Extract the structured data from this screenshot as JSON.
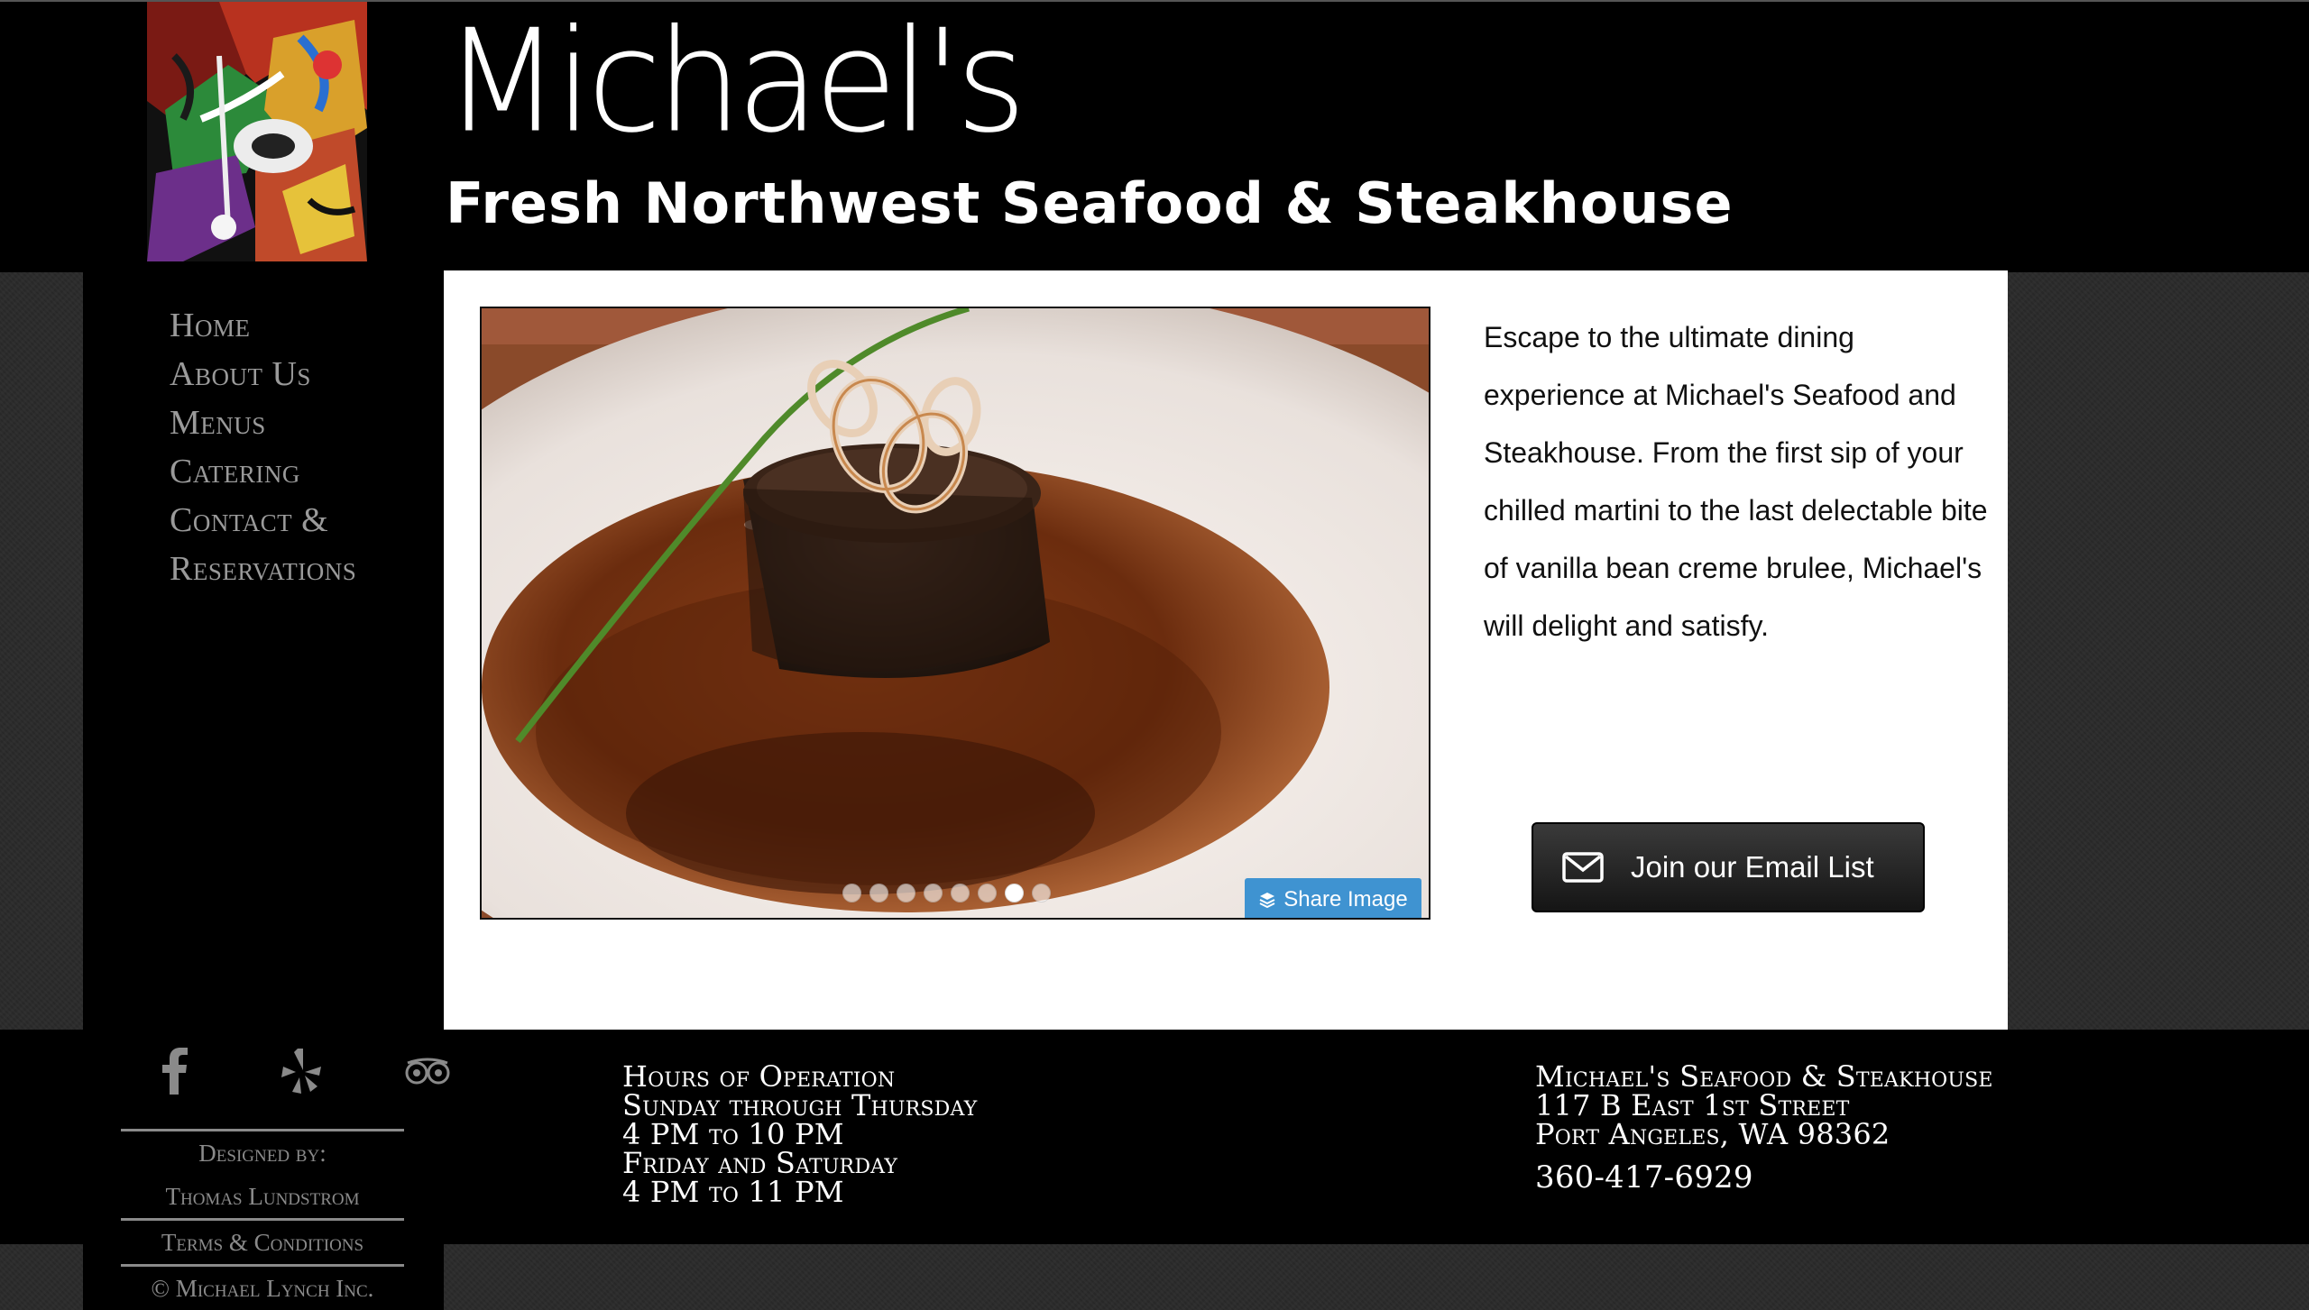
{
  "brand": {
    "title": "Michael's",
    "subtitle": "Fresh Northwest Seafood & Steakhouse"
  },
  "nav": {
    "items": [
      {
        "label": "Home"
      },
      {
        "label": "About Us"
      },
      {
        "label": "Menus"
      },
      {
        "label": "Catering"
      },
      {
        "label": "Contact &"
      },
      {
        "label": "Reservations"
      }
    ]
  },
  "slideshow": {
    "share_label": "Share Image",
    "share_icon": "layers-icon",
    "slide_count": 8,
    "active_slide": 7
  },
  "intro": {
    "text": "Escape to the ultimate dining experience at Michael's Seafood and Steakhouse. From the first sip of your chilled martini to the last delectable bite of vanilla bean creme brulee, Michael's will delight and satisfy."
  },
  "email": {
    "label": "Join our Email List",
    "icon": "envelope-icon"
  },
  "social": {
    "icons": [
      "facebook-icon",
      "yelp-icon",
      "tripadvisor-icon"
    ]
  },
  "credits": {
    "designed_by_label": "Designed by:",
    "designer": "Thomas Lundstrom",
    "terms": "Terms & Conditions",
    "copyright": "© Michael Lynch Inc."
  },
  "hours": {
    "title": "Hours of Operation",
    "line1": "Sunday through Thursday",
    "line2": "4 PM to 10 PM",
    "line3": "Friday and Saturday",
    "line4": "4 PM to 11 PM"
  },
  "address": {
    "name": "Michael's Seafood & Steakhouse",
    "street": "117 B East 1st Street",
    "city": "Port Angeles, WA 98362",
    "phone": "360-417-6929"
  },
  "colors": {
    "background": "#262626",
    "header": "#000000",
    "content": "#ffffff",
    "nav_text": "#9a9a9a",
    "share_button": "#3f93d1"
  }
}
